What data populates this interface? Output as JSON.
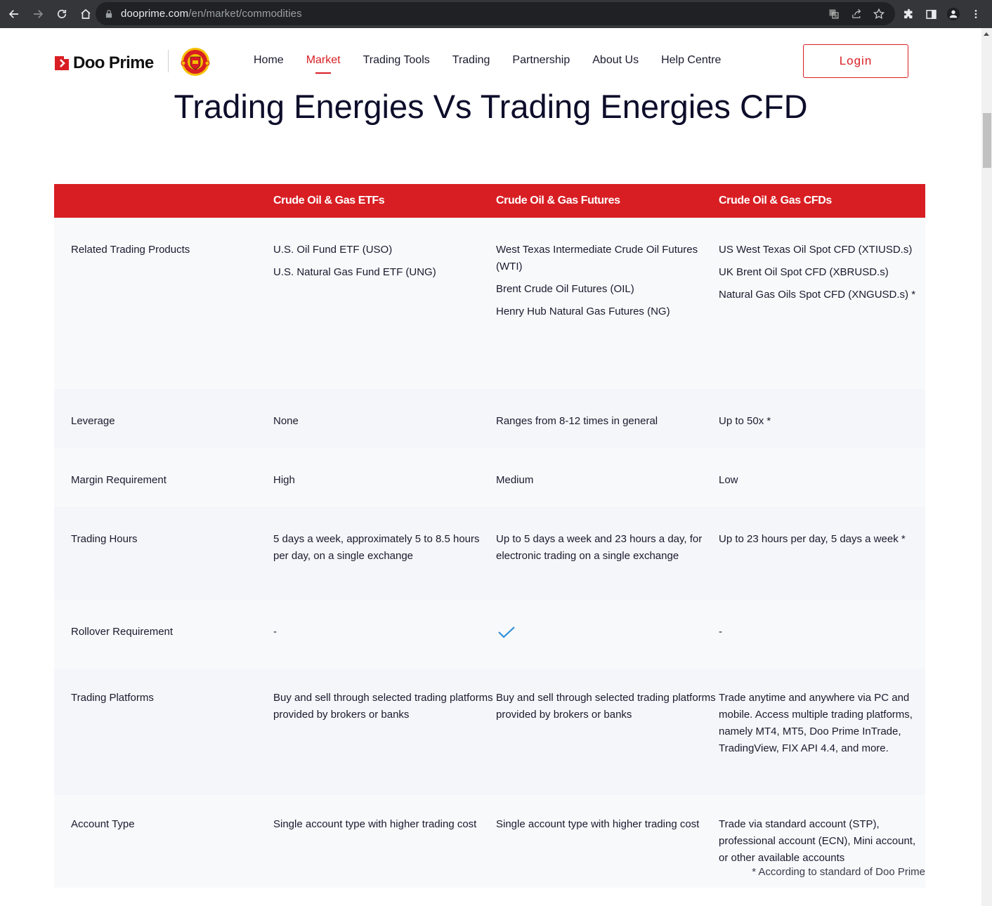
{
  "browser": {
    "url_host": "dooprime.com",
    "url_path": "/en/market/commodities",
    "buttons": {
      "back": "back-icon",
      "forward": "forward-icon",
      "reload": "reload-icon",
      "home": "home-icon"
    },
    "omnibox_icons": [
      "translate-icon",
      "share-icon",
      "bookmark-star-icon"
    ],
    "toolbar_icons": [
      "extensions-icon",
      "side-panel-icon",
      "profile-icon",
      "menu-icon"
    ]
  },
  "header": {
    "brand": "Doo Prime",
    "partner_logo": "manchester-united-crest",
    "nav": [
      {
        "label": "Home",
        "active": false
      },
      {
        "label": "Market",
        "active": true
      },
      {
        "label": "Trading Tools",
        "active": false
      },
      {
        "label": "Trading",
        "active": false
      },
      {
        "label": "Partnership",
        "active": false
      },
      {
        "label": "About Us",
        "active": false
      },
      {
        "label": "Help Centre",
        "active": false
      }
    ],
    "login_label": "Login"
  },
  "page": {
    "title": "Trading Energies Vs Trading Energies CFD"
  },
  "table": {
    "headers": [
      "",
      "Crude Oil & Gas ETFs",
      "Crude Oil & Gas Futures",
      "Crude Oil & Gas CFDs"
    ],
    "rows": [
      {
        "label": "Related Trading Products",
        "cells": [
          [
            "U.S. Oil Fund ETF (USO)",
            "U.S. Natural Gas Fund ETF (UNG)"
          ],
          [
            "West Texas Intermediate Crude Oil Futures (WTI)",
            "Brent Crude Oil Futures (OIL)",
            "Henry Hub Natural Gas Futures (NG)"
          ],
          [
            "US West Texas Oil Spot CFD (XTIUSD.s)",
            "UK Brent Oil Spot CFD (XBRUSD.s)",
            "Natural Gas Oils Spot CFD (XNGUSD.s) *"
          ]
        ]
      },
      {
        "label": "Leverage",
        "cells": [
          [
            "None"
          ],
          [
            "Ranges from 8-12 times in general"
          ],
          [
            "Up to 50x *"
          ]
        ]
      },
      {
        "label": "Margin Requirement",
        "cells": [
          [
            "High"
          ],
          [
            "Medium"
          ],
          [
            "Low"
          ]
        ]
      },
      {
        "label": "Trading Hours",
        "cells": [
          [
            "5 days a week, approximately 5 to 8.5 hours per day, on a single exchange"
          ],
          [
            "Up to 5 days a week and 23 hours a day, for electronic trading on a single exchange"
          ],
          [
            "Up to 23 hours per day, 5 days a week *"
          ]
        ]
      },
      {
        "label": "Rollover Requirement",
        "cells": [
          [
            "-"
          ],
          [
            "__check__"
          ],
          [
            "-"
          ]
        ]
      },
      {
        "label": "Trading Platforms",
        "cells": [
          [
            "Buy and sell through selected trading platforms provided by brokers or banks"
          ],
          [
            "Buy and sell through selected trading platforms provided by brokers or banks"
          ],
          [
            "Trade anytime and anywhere via PC and mobile. Access multiple trading platforms, namely MT4, MT5, Doo Prime InTrade, TradingView, FIX API 4.4, and more."
          ]
        ]
      },
      {
        "label": "Account Type",
        "cells": [
          [
            "Single account type with higher trading cost"
          ],
          [
            "Single account type with higher trading cost"
          ],
          [
            "Trade via standard account (STP), professional account (ECN), Mini account, or other available accounts"
          ]
        ]
      }
    ]
  },
  "footnote": "* According to standard of Doo Prime",
  "colors": {
    "brand_red": "#d81e23",
    "check_blue": "#2f8fd8",
    "row_bg_a": "#f8f9fb",
    "row_bg_b": "#f5f6f9"
  }
}
